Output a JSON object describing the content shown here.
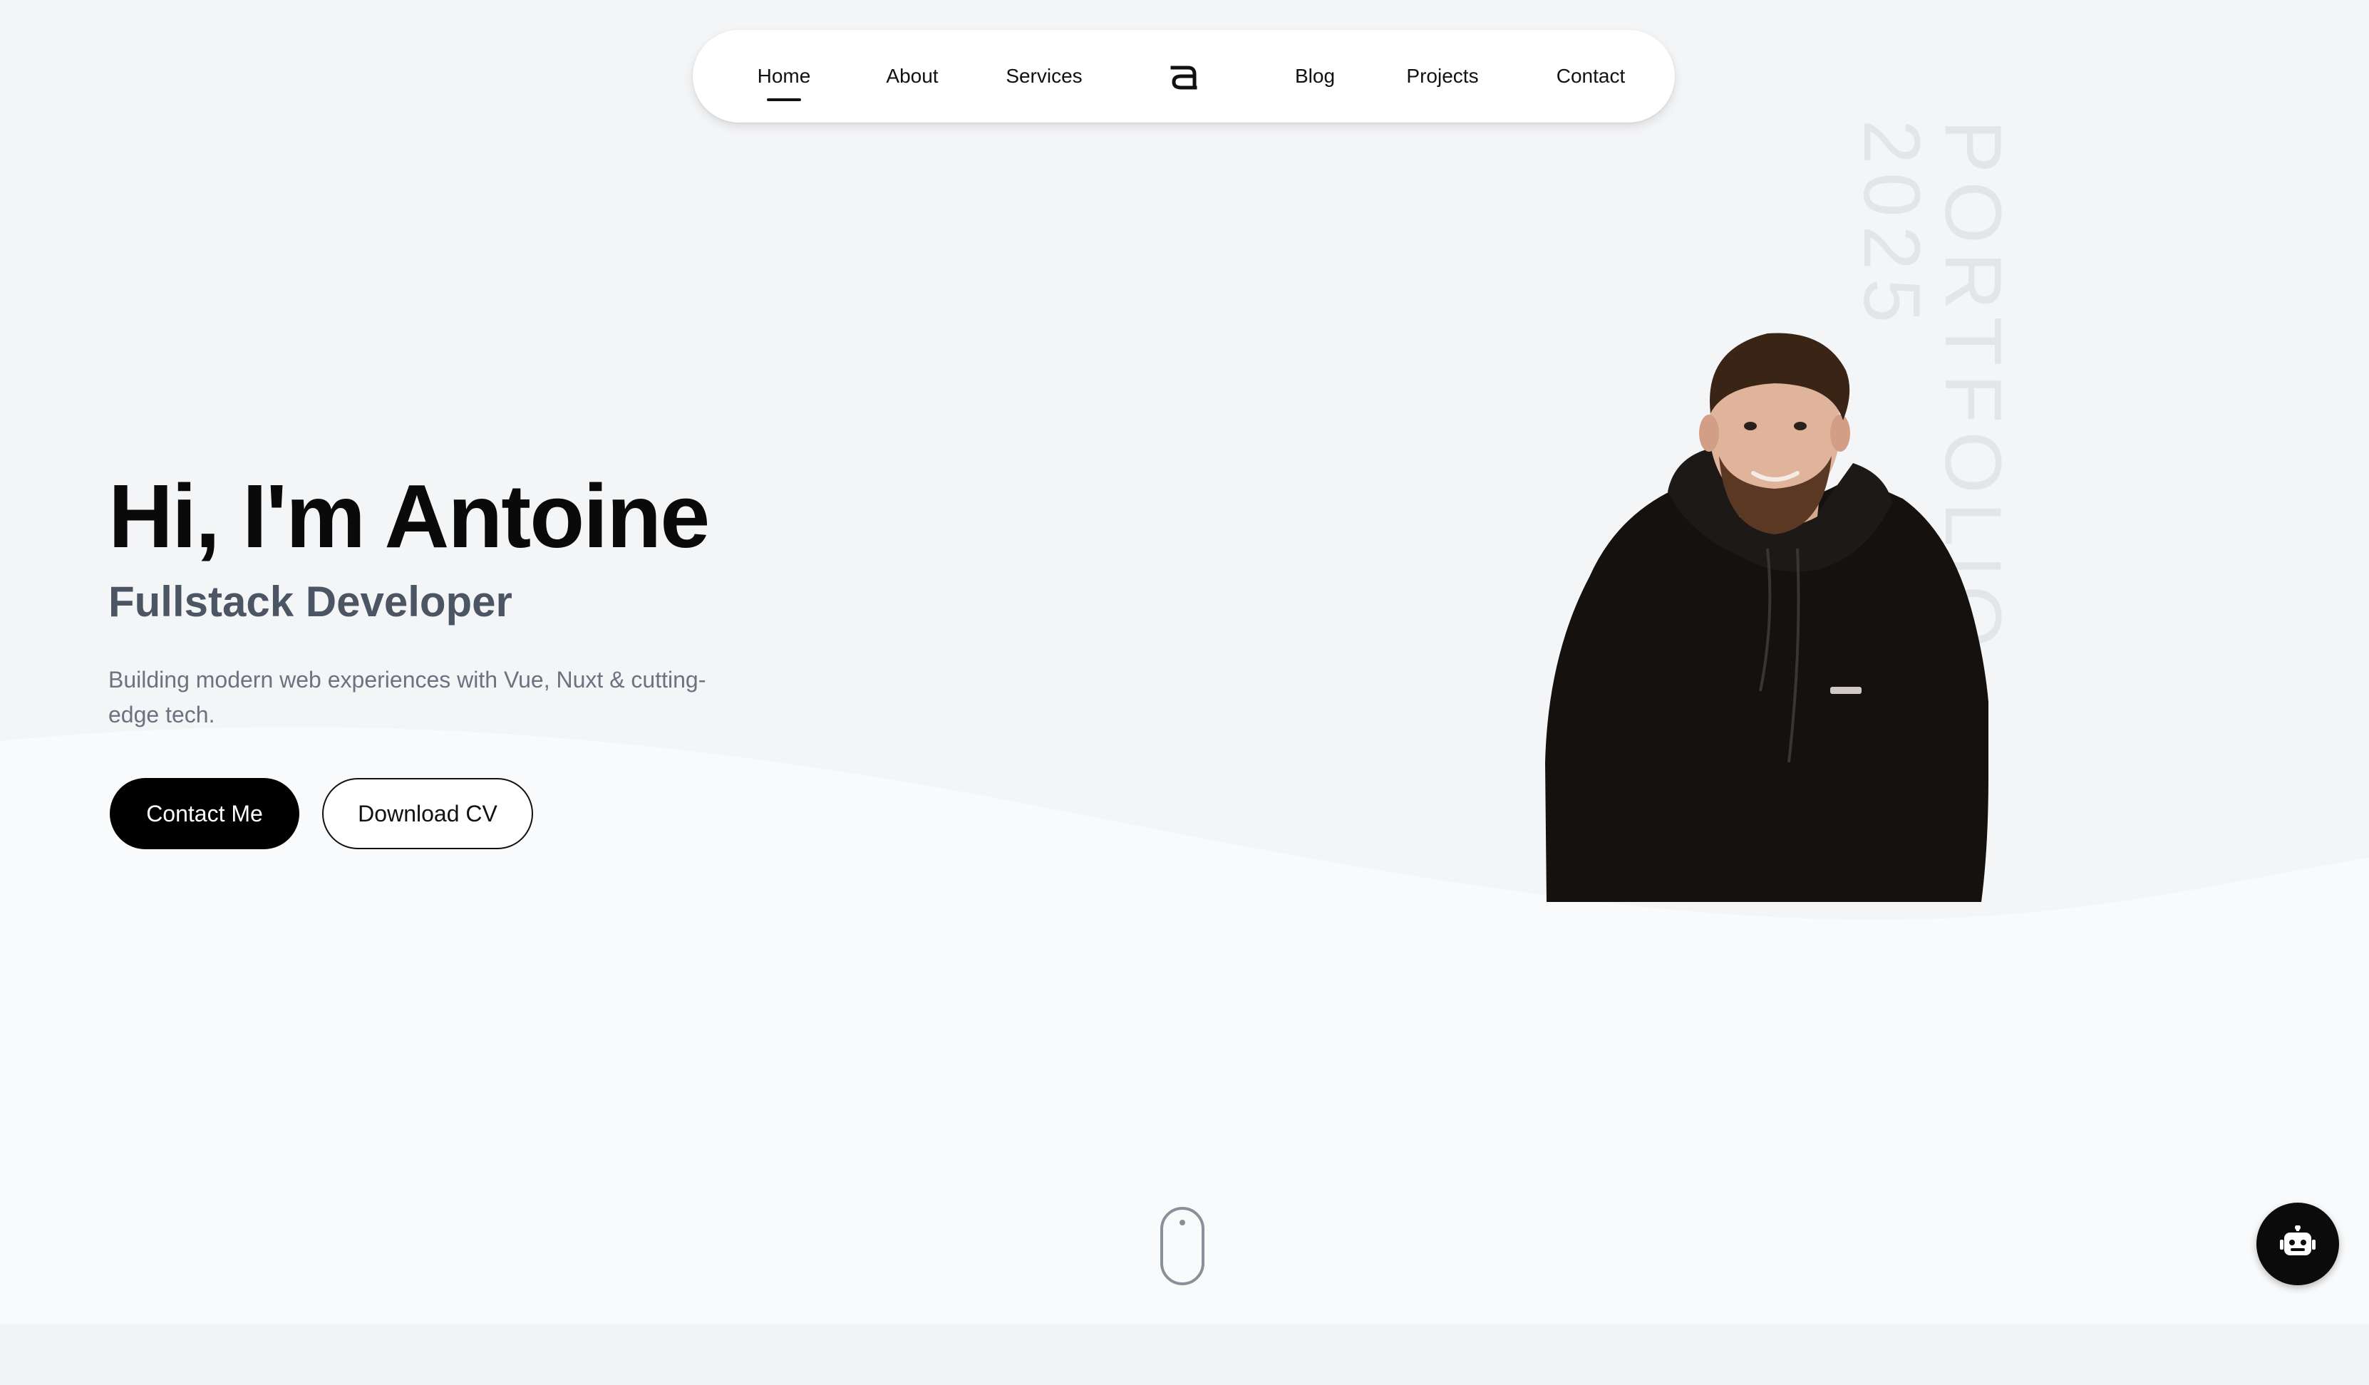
{
  "nav": {
    "items": [
      {
        "label": "Home",
        "active": true
      },
      {
        "label": "About",
        "active": false
      },
      {
        "label": "Services",
        "active": false
      },
      {
        "label": "Blog",
        "active": false
      },
      {
        "label": "Projects",
        "active": false
      },
      {
        "label": "Contact",
        "active": false
      }
    ],
    "logo_icon": "a-logo-icon"
  },
  "hero": {
    "title": "Hi, I'm Antoine",
    "subtitle": "Fullstack Developer",
    "description": "Building modern web experiences with Vue, Nuxt & cutting-edge tech.",
    "primary_button": "Contact Me",
    "secondary_button": "Download CV"
  },
  "side_text": {
    "portfolio": "PORTFOLIO",
    "year": "2025"
  },
  "scroll_indicator_icon": "mouse-scroll-icon",
  "chatbot_icon": "robot-icon",
  "colors": {
    "background": "#f4f5f7",
    "accent": "#000000",
    "subtitle": "#4b5563",
    "muted_text": "#6b7280",
    "vertical_text": "#e4e5e8"
  }
}
